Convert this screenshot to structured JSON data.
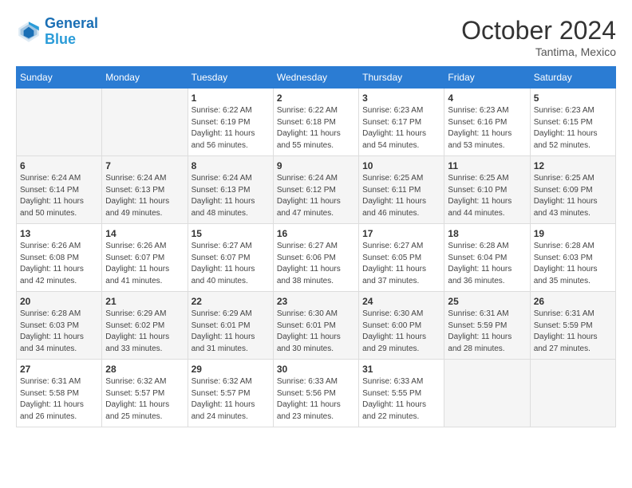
{
  "header": {
    "logo_line1": "General",
    "logo_line2": "Blue",
    "month": "October 2024",
    "location": "Tantima, Mexico"
  },
  "weekdays": [
    "Sunday",
    "Monday",
    "Tuesday",
    "Wednesday",
    "Thursday",
    "Friday",
    "Saturday"
  ],
  "weeks": [
    [
      {
        "day": "",
        "sunrise": "",
        "sunset": "",
        "daylight": ""
      },
      {
        "day": "",
        "sunrise": "",
        "sunset": "",
        "daylight": ""
      },
      {
        "day": "1",
        "sunrise": "Sunrise: 6:22 AM",
        "sunset": "Sunset: 6:19 PM",
        "daylight": "Daylight: 11 hours and 56 minutes."
      },
      {
        "day": "2",
        "sunrise": "Sunrise: 6:22 AM",
        "sunset": "Sunset: 6:18 PM",
        "daylight": "Daylight: 11 hours and 55 minutes."
      },
      {
        "day": "3",
        "sunrise": "Sunrise: 6:23 AM",
        "sunset": "Sunset: 6:17 PM",
        "daylight": "Daylight: 11 hours and 54 minutes."
      },
      {
        "day": "4",
        "sunrise": "Sunrise: 6:23 AM",
        "sunset": "Sunset: 6:16 PM",
        "daylight": "Daylight: 11 hours and 53 minutes."
      },
      {
        "day": "5",
        "sunrise": "Sunrise: 6:23 AM",
        "sunset": "Sunset: 6:15 PM",
        "daylight": "Daylight: 11 hours and 52 minutes."
      }
    ],
    [
      {
        "day": "6",
        "sunrise": "Sunrise: 6:24 AM",
        "sunset": "Sunset: 6:14 PM",
        "daylight": "Daylight: 11 hours and 50 minutes."
      },
      {
        "day": "7",
        "sunrise": "Sunrise: 6:24 AM",
        "sunset": "Sunset: 6:13 PM",
        "daylight": "Daylight: 11 hours and 49 minutes."
      },
      {
        "day": "8",
        "sunrise": "Sunrise: 6:24 AM",
        "sunset": "Sunset: 6:13 PM",
        "daylight": "Daylight: 11 hours and 48 minutes."
      },
      {
        "day": "9",
        "sunrise": "Sunrise: 6:24 AM",
        "sunset": "Sunset: 6:12 PM",
        "daylight": "Daylight: 11 hours and 47 minutes."
      },
      {
        "day": "10",
        "sunrise": "Sunrise: 6:25 AM",
        "sunset": "Sunset: 6:11 PM",
        "daylight": "Daylight: 11 hours and 46 minutes."
      },
      {
        "day": "11",
        "sunrise": "Sunrise: 6:25 AM",
        "sunset": "Sunset: 6:10 PM",
        "daylight": "Daylight: 11 hours and 44 minutes."
      },
      {
        "day": "12",
        "sunrise": "Sunrise: 6:25 AM",
        "sunset": "Sunset: 6:09 PM",
        "daylight": "Daylight: 11 hours and 43 minutes."
      }
    ],
    [
      {
        "day": "13",
        "sunrise": "Sunrise: 6:26 AM",
        "sunset": "Sunset: 6:08 PM",
        "daylight": "Daylight: 11 hours and 42 minutes."
      },
      {
        "day": "14",
        "sunrise": "Sunrise: 6:26 AM",
        "sunset": "Sunset: 6:07 PM",
        "daylight": "Daylight: 11 hours and 41 minutes."
      },
      {
        "day": "15",
        "sunrise": "Sunrise: 6:27 AM",
        "sunset": "Sunset: 6:07 PM",
        "daylight": "Daylight: 11 hours and 40 minutes."
      },
      {
        "day": "16",
        "sunrise": "Sunrise: 6:27 AM",
        "sunset": "Sunset: 6:06 PM",
        "daylight": "Daylight: 11 hours and 38 minutes."
      },
      {
        "day": "17",
        "sunrise": "Sunrise: 6:27 AM",
        "sunset": "Sunset: 6:05 PM",
        "daylight": "Daylight: 11 hours and 37 minutes."
      },
      {
        "day": "18",
        "sunrise": "Sunrise: 6:28 AM",
        "sunset": "Sunset: 6:04 PM",
        "daylight": "Daylight: 11 hours and 36 minutes."
      },
      {
        "day": "19",
        "sunrise": "Sunrise: 6:28 AM",
        "sunset": "Sunset: 6:03 PM",
        "daylight": "Daylight: 11 hours and 35 minutes."
      }
    ],
    [
      {
        "day": "20",
        "sunrise": "Sunrise: 6:28 AM",
        "sunset": "Sunset: 6:03 PM",
        "daylight": "Daylight: 11 hours and 34 minutes."
      },
      {
        "day": "21",
        "sunrise": "Sunrise: 6:29 AM",
        "sunset": "Sunset: 6:02 PM",
        "daylight": "Daylight: 11 hours and 33 minutes."
      },
      {
        "day": "22",
        "sunrise": "Sunrise: 6:29 AM",
        "sunset": "Sunset: 6:01 PM",
        "daylight": "Daylight: 11 hours and 31 minutes."
      },
      {
        "day": "23",
        "sunrise": "Sunrise: 6:30 AM",
        "sunset": "Sunset: 6:01 PM",
        "daylight": "Daylight: 11 hours and 30 minutes."
      },
      {
        "day": "24",
        "sunrise": "Sunrise: 6:30 AM",
        "sunset": "Sunset: 6:00 PM",
        "daylight": "Daylight: 11 hours and 29 minutes."
      },
      {
        "day": "25",
        "sunrise": "Sunrise: 6:31 AM",
        "sunset": "Sunset: 5:59 PM",
        "daylight": "Daylight: 11 hours and 28 minutes."
      },
      {
        "day": "26",
        "sunrise": "Sunrise: 6:31 AM",
        "sunset": "Sunset: 5:59 PM",
        "daylight": "Daylight: 11 hours and 27 minutes."
      }
    ],
    [
      {
        "day": "27",
        "sunrise": "Sunrise: 6:31 AM",
        "sunset": "Sunset: 5:58 PM",
        "daylight": "Daylight: 11 hours and 26 minutes."
      },
      {
        "day": "28",
        "sunrise": "Sunrise: 6:32 AM",
        "sunset": "Sunset: 5:57 PM",
        "daylight": "Daylight: 11 hours and 25 minutes."
      },
      {
        "day": "29",
        "sunrise": "Sunrise: 6:32 AM",
        "sunset": "Sunset: 5:57 PM",
        "daylight": "Daylight: 11 hours and 24 minutes."
      },
      {
        "day": "30",
        "sunrise": "Sunrise: 6:33 AM",
        "sunset": "Sunset: 5:56 PM",
        "daylight": "Daylight: 11 hours and 23 minutes."
      },
      {
        "day": "31",
        "sunrise": "Sunrise: 6:33 AM",
        "sunset": "Sunset: 5:55 PM",
        "daylight": "Daylight: 11 hours and 22 minutes."
      },
      {
        "day": "",
        "sunrise": "",
        "sunset": "",
        "daylight": ""
      },
      {
        "day": "",
        "sunrise": "",
        "sunset": "",
        "daylight": ""
      }
    ]
  ]
}
